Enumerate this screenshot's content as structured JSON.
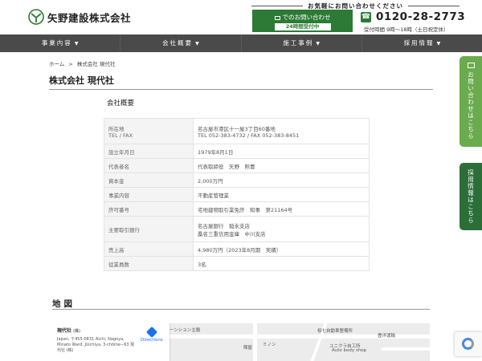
{
  "header": {
    "company_name": "矢野建設株式会社",
    "contact_caption": "お気軽にお問い合わせください",
    "mail_button": {
      "label": "でのお問い合わせ",
      "sub": "24時間受付中"
    },
    "phone": "0120-28-2773",
    "hours": "受付時間 9時〜18時（土日祝定休）",
    "brand_color": "#2c7a35"
  },
  "nav": [
    {
      "label": "事業内容"
    },
    {
      "label": "会社概要"
    },
    {
      "label": "施工事例"
    },
    {
      "label": "採用情報"
    }
  ],
  "breadcrumb": {
    "home": "ホーム",
    "sep": ">",
    "current": "株式会社 現代社"
  },
  "page_title": "株式会社 現代社",
  "section_label": "会社概要",
  "company_table": [
    {
      "head": [
        "所在地",
        "TEL / FAX"
      ],
      "value": [
        "名古屋市港区十一屋3丁目60番地",
        "TEL 052-383-4732 / FAX 052-383-8451"
      ]
    },
    {
      "head": [
        "設立年月日"
      ],
      "value": [
        "1979年8月1日"
      ]
    },
    {
      "head": [
        "代表者名"
      ],
      "value": [
        "代表取締役　矢野　照豊"
      ]
    },
    {
      "head": [
        "資本金"
      ],
      "value": [
        "2,000万円"
      ]
    },
    {
      "head": [
        "事業内容"
      ],
      "value": [
        "不動産管理業"
      ]
    },
    {
      "head": [
        "許可番号"
      ],
      "value": [
        "宅地建物取引業免許　知事　第21164号"
      ]
    },
    {
      "head": [
        "主要取引銀行"
      ],
      "value": [
        "名古屋銀行　稲永支店",
        "桑名三重信用金庫　中川支店"
      ]
    },
    {
      "head": [
        "売上高"
      ],
      "value": [
        "4,980万円（2023年8月期　実績）"
      ]
    },
    {
      "head": [
        "従業員数"
      ],
      "value": [
        "3名"
      ]
    }
  ],
  "map": {
    "title": "地図",
    "place_name": "現代社",
    "place_suffix": "(株)",
    "address": "Japan, 〒455-0831 Aichi, Nagoya, Minato Ward, Jūichiya, 3-chōme−63 現代社 (株)",
    "directions": "Directions",
    "labels": [
      "ーンション主題",
      "桜七自動車整備所",
      "ユニクラ自工所",
      "Auto body shop",
      "豊洋運輸",
      "ミノン",
      "陣屋"
    ]
  },
  "side_tabs": {
    "contact": "お問い合わせはこちら",
    "recruit": "採用情報はこちら"
  },
  "colors": {
    "nav_bg": "#4a4a4a",
    "contact_tab": "#6aab4e",
    "recruit_tab": "#2c6e38"
  }
}
